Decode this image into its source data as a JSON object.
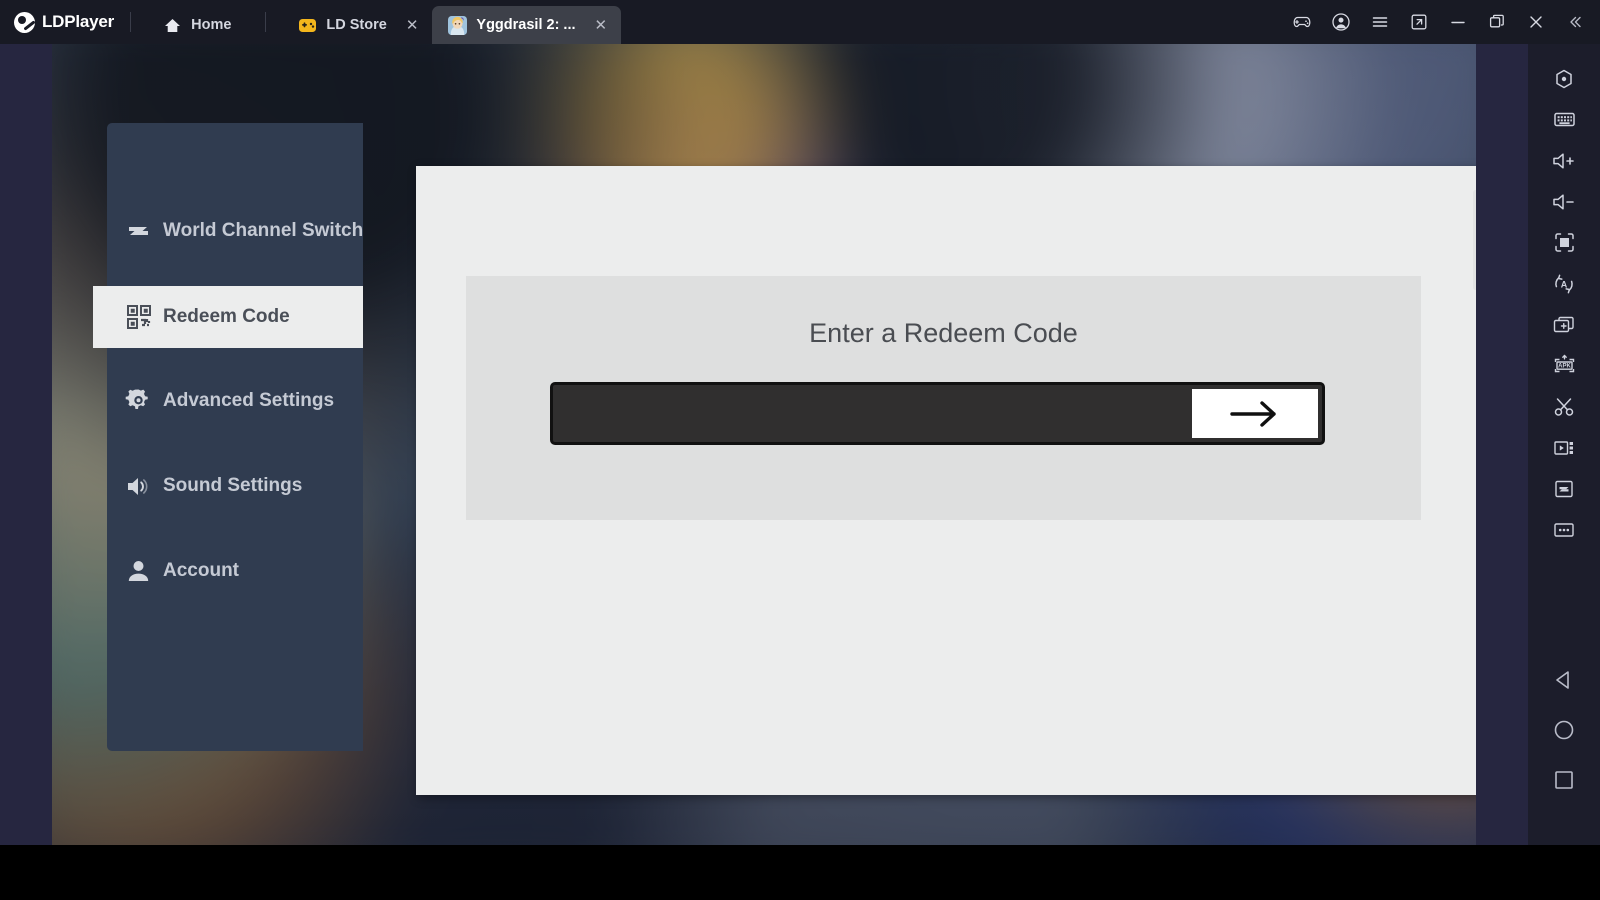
{
  "app": {
    "brand": "LDPlayer",
    "brand_logo_icon": "ldplayer-logo-icon"
  },
  "titlebar": {
    "tabs": [
      {
        "label": "Home",
        "icon": "home-icon",
        "closable": false,
        "active": false
      },
      {
        "label": "LD Store",
        "icon": "gamepad-store-icon",
        "closable": true,
        "active": false
      },
      {
        "label": "Yggdrasil 2: ...",
        "icon": "game-avatar-icon",
        "closable": true,
        "active": true
      }
    ],
    "close_glyph": "✕",
    "buttons": [
      {
        "name": "gamepad-icon",
        "title": "Keyboard mapping"
      },
      {
        "name": "account-icon",
        "title": "Account"
      },
      {
        "name": "menu-icon",
        "title": "Menu"
      },
      {
        "name": "new-instance-icon",
        "title": "New window"
      },
      {
        "name": "minimize-icon",
        "title": "Minimize"
      },
      {
        "name": "maximize-icon",
        "title": "Maximize"
      },
      {
        "name": "close-icon",
        "title": "Close"
      },
      {
        "name": "collapse-icon",
        "title": "Collapse sidebar"
      }
    ]
  },
  "game_menu": {
    "items": [
      {
        "label": "World Channel Switch",
        "icon": "switch-arrows-icon",
        "selected": false
      },
      {
        "label": "Redeem Code",
        "icon": "qr-code-icon",
        "selected": true
      },
      {
        "label": "Advanced Settings",
        "icon": "gear-icon",
        "selected": false
      },
      {
        "label": "Sound Settings",
        "icon": "speaker-icon",
        "selected": false
      },
      {
        "label": "Account",
        "icon": "person-icon",
        "selected": false
      }
    ]
  },
  "redeem_dialog": {
    "title": "Enter a Redeem Code",
    "input_value": "",
    "input_placeholder": "",
    "submit_icon": "arrow-right-icon",
    "submit_glyph": "→"
  },
  "right_toolbar": {
    "buttons": [
      {
        "name": "home-hex-icon",
        "title": "Home"
      },
      {
        "name": "keyboard-icon",
        "title": "Keyboard"
      },
      {
        "name": "volume-up-icon",
        "title": "Volume up"
      },
      {
        "name": "volume-down-icon",
        "title": "Volume down"
      },
      {
        "name": "fullscreen-icon",
        "title": "Fullscreen"
      },
      {
        "name": "auto-rotate-icon",
        "title": "Rotate"
      },
      {
        "name": "multi-instance-icon",
        "title": "Multi instance"
      },
      {
        "name": "apk-install-icon",
        "title": "Install APK"
      },
      {
        "name": "scissors-icon",
        "title": "Screenshot"
      },
      {
        "name": "video-record-icon",
        "title": "Record"
      },
      {
        "name": "shared-folder-icon",
        "title": "Shared folder"
      },
      {
        "name": "more-icon",
        "title": "More"
      }
    ],
    "nav": [
      {
        "name": "back-triangle-icon",
        "title": "Back"
      },
      {
        "name": "home-circle-icon",
        "title": "Home"
      },
      {
        "name": "recents-square-icon",
        "title": "Recents"
      }
    ]
  },
  "colors": {
    "titlebar_bg": "#181a24",
    "emulator_pad": "#262640",
    "toolbar_bg": "#1c1d2b",
    "menu_bg": "#303c50",
    "dialog_bg": "#eceded",
    "panel_bg": "#dedfdf",
    "input_bg": "#302f2f",
    "accent_white": "#ffffff"
  }
}
